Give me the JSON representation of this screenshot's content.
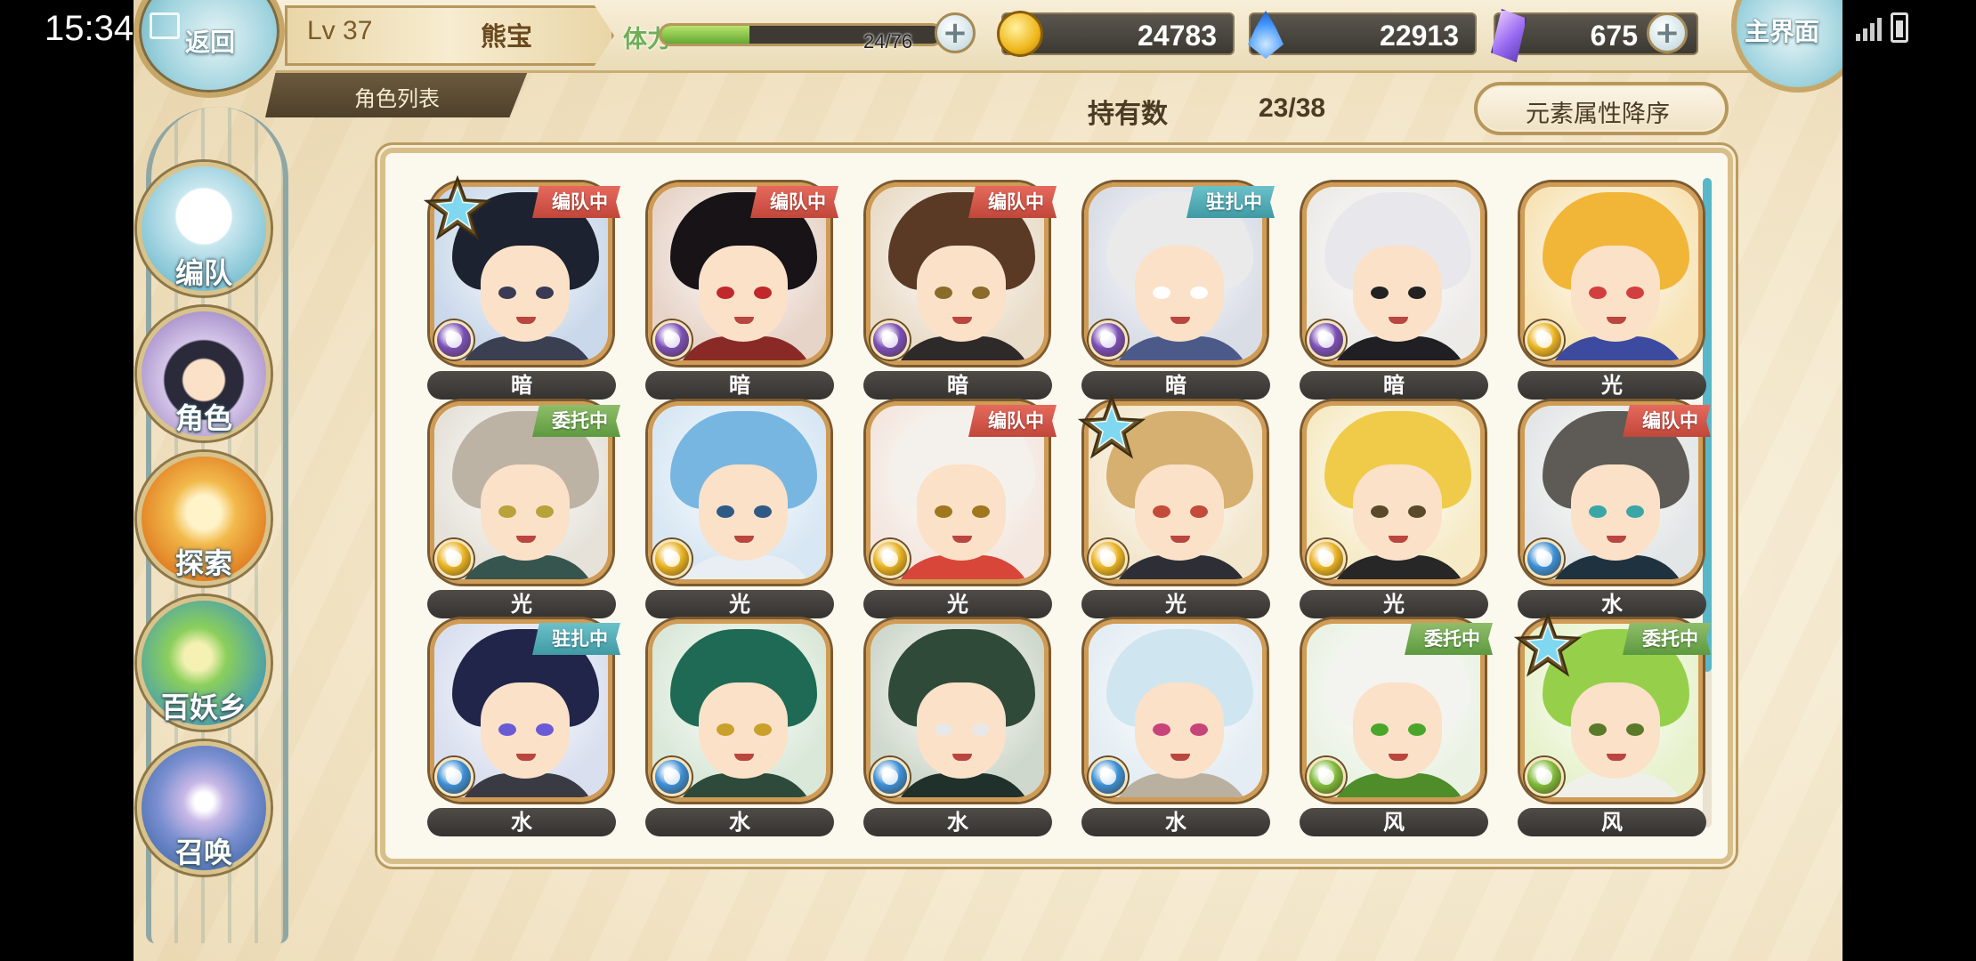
{
  "status_bar": {
    "time": "15:34"
  },
  "header": {
    "back_label": "返回",
    "level": "Lv 37",
    "player_name": "熊宝",
    "section_tab": "角色列表",
    "stamina": {
      "label": "体力",
      "current": 24,
      "max": 76,
      "text": "24/76",
      "fill_fraction": 0.316
    },
    "gold": "24783",
    "gems": "22913",
    "crystals": "675",
    "main_label": "主界面"
  },
  "toolbar": {
    "owned_label": "持有数",
    "owned_value": "23/38",
    "sort_label": "元素属性降序"
  },
  "nav": [
    {
      "label": "编队",
      "icon": "ghost-team-icon"
    },
    {
      "label": "角色",
      "icon": "character-icon"
    },
    {
      "label": "探索",
      "icon": "explore-scroll-icon"
    },
    {
      "label": "百妖乡",
      "icon": "village-icon"
    },
    {
      "label": "召唤",
      "icon": "summon-swirl-icon"
    }
  ],
  "characters": [
    {
      "element": "暗",
      "tag": "编队中",
      "tag_type": "team",
      "star": true
    },
    {
      "element": "暗",
      "tag": "编队中",
      "tag_type": "team",
      "star": false
    },
    {
      "element": "暗",
      "tag": "编队中",
      "tag_type": "team",
      "star": false
    },
    {
      "element": "暗",
      "tag": "驻扎中",
      "tag_type": "camp",
      "star": false
    },
    {
      "element": "暗",
      "tag": "",
      "tag_type": "",
      "star": false
    },
    {
      "element": "光",
      "tag": "",
      "tag_type": "",
      "star": false
    },
    {
      "element": "光",
      "tag": "委托中",
      "tag_type": "commission",
      "star": false
    },
    {
      "element": "光",
      "tag": "",
      "tag_type": "",
      "star": false
    },
    {
      "element": "光",
      "tag": "编队中",
      "tag_type": "team",
      "star": false
    },
    {
      "element": "光",
      "tag": "",
      "tag_type": "",
      "star": true
    },
    {
      "element": "光",
      "tag": "",
      "tag_type": "",
      "star": false
    },
    {
      "element": "水",
      "tag": "编队中",
      "tag_type": "team",
      "star": false
    },
    {
      "element": "水",
      "tag": "驻扎中",
      "tag_type": "camp",
      "star": false
    },
    {
      "element": "水",
      "tag": "",
      "tag_type": "",
      "star": false
    },
    {
      "element": "水",
      "tag": "",
      "tag_type": "",
      "star": false
    },
    {
      "element": "水",
      "tag": "",
      "tag_type": "",
      "star": false
    },
    {
      "element": "风",
      "tag": "委托中",
      "tag_type": "commission",
      "star": false
    },
    {
      "element": "风",
      "tag": "委托中",
      "tag_type": "commission",
      "star": true
    }
  ],
  "element_colors": {
    "暗": "#7a4fb5",
    "光": "#e9b323",
    "水": "#3d8fd6",
    "风": "#7fba3a"
  }
}
